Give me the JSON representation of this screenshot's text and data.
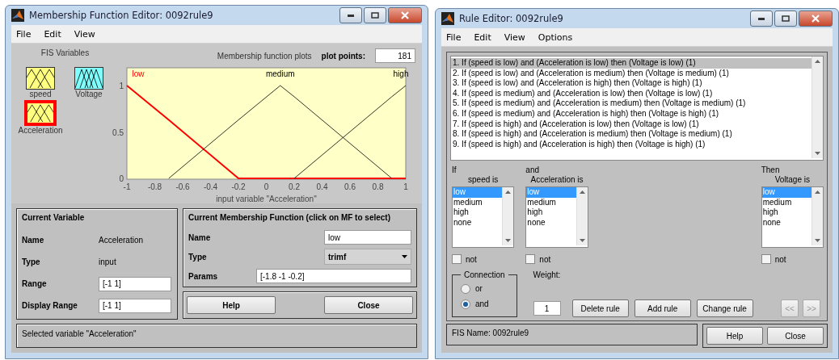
{
  "mf_editor": {
    "title": "Membership Function Editor: 0092rule9",
    "menu": [
      "File",
      "Edit",
      "View"
    ],
    "fis_variables": {
      "title": "FIS Variables",
      "items": [
        {
          "label": "speed",
          "color": "#ffff80",
          "selected": false
        },
        {
          "label": "Voltage",
          "color": "#80ffff",
          "selected": false
        },
        {
          "label": "Acceleration",
          "color": "#ffff80",
          "selected": true
        }
      ]
    },
    "plot_title": "Membership function plots",
    "plot_points": {
      "label": "plot points:",
      "value": "181"
    },
    "chart_data": {
      "type": "line",
      "xlabel": "input variable \"Acceleration\"",
      "x": [
        -1,
        -0.7,
        -0.2,
        0.1,
        0.2,
        0.9,
        1
      ],
      "xlim": [
        -1,
        1
      ],
      "ylim": [
        0,
        1.2
      ],
      "xticks": [
        -1,
        -0.8,
        -0.6,
        -0.4,
        -0.2,
        0,
        0.2,
        0.4,
        0.6,
        0.8,
        1
      ],
      "yticks": [
        0,
        0.5,
        1
      ],
      "series": [
        {
          "name": "low",
          "color": "#ff0000",
          "values": [
            1,
            0.63,
            0,
            0,
            0,
            0,
            0
          ]
        },
        {
          "name": "medium",
          "color": "#000000",
          "values": [
            null,
            0,
            0.63,
            1,
            0.88,
            0,
            null
          ]
        },
        {
          "name": "high",
          "color": "#000000",
          "values": [
            null,
            null,
            null,
            null,
            0,
            0.88,
            1
          ]
        }
      ]
    },
    "current_variable": {
      "title": "Current Variable",
      "fields": [
        {
          "label": "Name",
          "value": "Acceleration",
          "kind": "text"
        },
        {
          "label": "Type",
          "value": "input",
          "kind": "text"
        },
        {
          "label": "Range",
          "value": "[-1 1]",
          "kind": "input"
        },
        {
          "label": "Display Range",
          "value": "[-1 1]",
          "kind": "input"
        }
      ]
    },
    "current_mf": {
      "title": "Current Membership Function (click on MF to select)",
      "name_label": "Name",
      "name": "low",
      "type_label": "Type",
      "type": "trimf",
      "params_label": "Params",
      "params": "[-1.8 -1 -0.2]"
    },
    "buttons": [
      "Help",
      "Close"
    ],
    "status": "Selected variable \"Acceleration\""
  },
  "rule_editor": {
    "title": "Rule Editor: 0092rule9",
    "menu": [
      "File",
      "Edit",
      "View",
      "Options"
    ],
    "rules": [
      {
        "text": "1. If (speed is low) and (Acceleration is low) then (Voltage is low) (1)",
        "selected": true
      },
      {
        "text": "2. If (speed is low) and (Acceleration is medium) then (Voltage is medium) (1)",
        "selected": false
      },
      {
        "text": "3. If (speed is low) and (Acceleration is high) then (Voltage is high) (1)",
        "selected": false
      },
      {
        "text": "4. If (speed is medium) and (Acceleration is low) then (Voltage is low) (1)",
        "selected": false
      },
      {
        "text": "5. If (speed is medium) and (Acceleration is medium) then (Voltage is medium) (1)",
        "selected": false
      },
      {
        "text": "6. If (speed is medium) and (Acceleration is high) then (Voltage is high) (1)",
        "selected": false
      },
      {
        "text": "7. If (speed is high) and (Acceleration is low) then (Voltage is low) (1)",
        "selected": false
      },
      {
        "text": "8. If (speed is high) and (Acceleration is medium) then (Voltage is medium) (1)",
        "selected": false
      },
      {
        "text": "9. If (speed is high) and (Acceleration is high) then (Voltage is high) (1)",
        "selected": false
      }
    ],
    "clauses": [
      {
        "head": "If",
        "label": "speed is",
        "not_label": "not",
        "not": false,
        "options": [
          {
            "label": "low",
            "selected": true
          },
          {
            "label": "medium",
            "selected": false
          },
          {
            "label": "high",
            "selected": false
          },
          {
            "label": "none",
            "selected": false
          }
        ]
      },
      {
        "head": "and",
        "label": "Acceleration is",
        "not_label": "not",
        "not": false,
        "options": [
          {
            "label": "low",
            "selected": true
          },
          {
            "label": "medium",
            "selected": false
          },
          {
            "label": "high",
            "selected": false
          },
          {
            "label": "none",
            "selected": false
          }
        ]
      },
      {
        "head": "Then",
        "label": "Voltage is",
        "not_label": "not",
        "not": false,
        "options": [
          {
            "label": "low",
            "selected": true
          },
          {
            "label": "medium",
            "selected": false
          },
          {
            "label": "high",
            "selected": false
          },
          {
            "label": "none",
            "selected": false
          }
        ]
      }
    ],
    "connection": {
      "title": "Connection",
      "options": [
        {
          "label": "or",
          "selected": false
        },
        {
          "label": "and",
          "selected": true
        }
      ]
    },
    "weight": {
      "label": "Weight:",
      "value": "1"
    },
    "actions": [
      "Delete rule",
      "Add rule",
      "Change rule"
    ],
    "nav": [
      {
        "label": "<<",
        "disabled": true
      },
      {
        "label": ">>",
        "disabled": true
      }
    ],
    "fis_name": "FIS Name: 0092rule9",
    "buttons": [
      "Help",
      "Close"
    ]
  }
}
